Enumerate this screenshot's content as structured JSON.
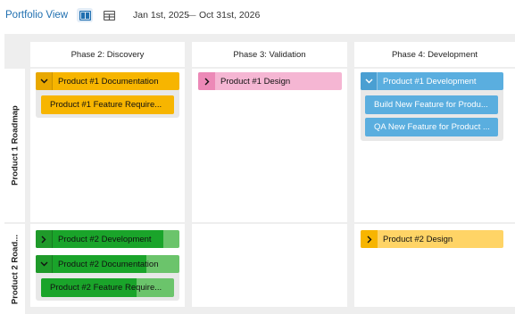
{
  "header": {
    "title": "Portfolio View",
    "view_icons": [
      "split-view-icon",
      "table-view-icon"
    ],
    "date_start": "Jan 1st, 2025",
    "date_separator": "—",
    "date_end": "Oct 31st, 2026"
  },
  "columns": [
    "Phase 2: Discovery",
    "Phase 3: Validation",
    "Phase 4: Development"
  ],
  "rows": [
    "Product 1 Roadmap",
    "Product 2 Road..."
  ],
  "colors": {
    "orange": "#f7b500",
    "pink": "#f5b6d3",
    "blue": "#5aaedf",
    "green": "#1aa42a",
    "yellow": "#ffd466"
  },
  "cards": {
    "r1_discovery": {
      "parent": "Product #1 Documentation",
      "children": [
        "Product #1 Feature Require..."
      ]
    },
    "r1_validation": {
      "parent": "Product #1 Design"
    },
    "r1_development": {
      "parent": "Product #1 Development",
      "children": [
        "Build New Feature for Produ...",
        "QA New Feature for Product ..."
      ]
    },
    "r2_discovery": {
      "development": "Product #2 Development",
      "development_progress": 0.89,
      "documentation": "Product #2 Documentation",
      "documentation_progress": 0.77,
      "feature": "Product #2 Feature Require...",
      "feature_progress": 0.72
    },
    "r2_development": {
      "parent": "Product #2 Design"
    }
  }
}
